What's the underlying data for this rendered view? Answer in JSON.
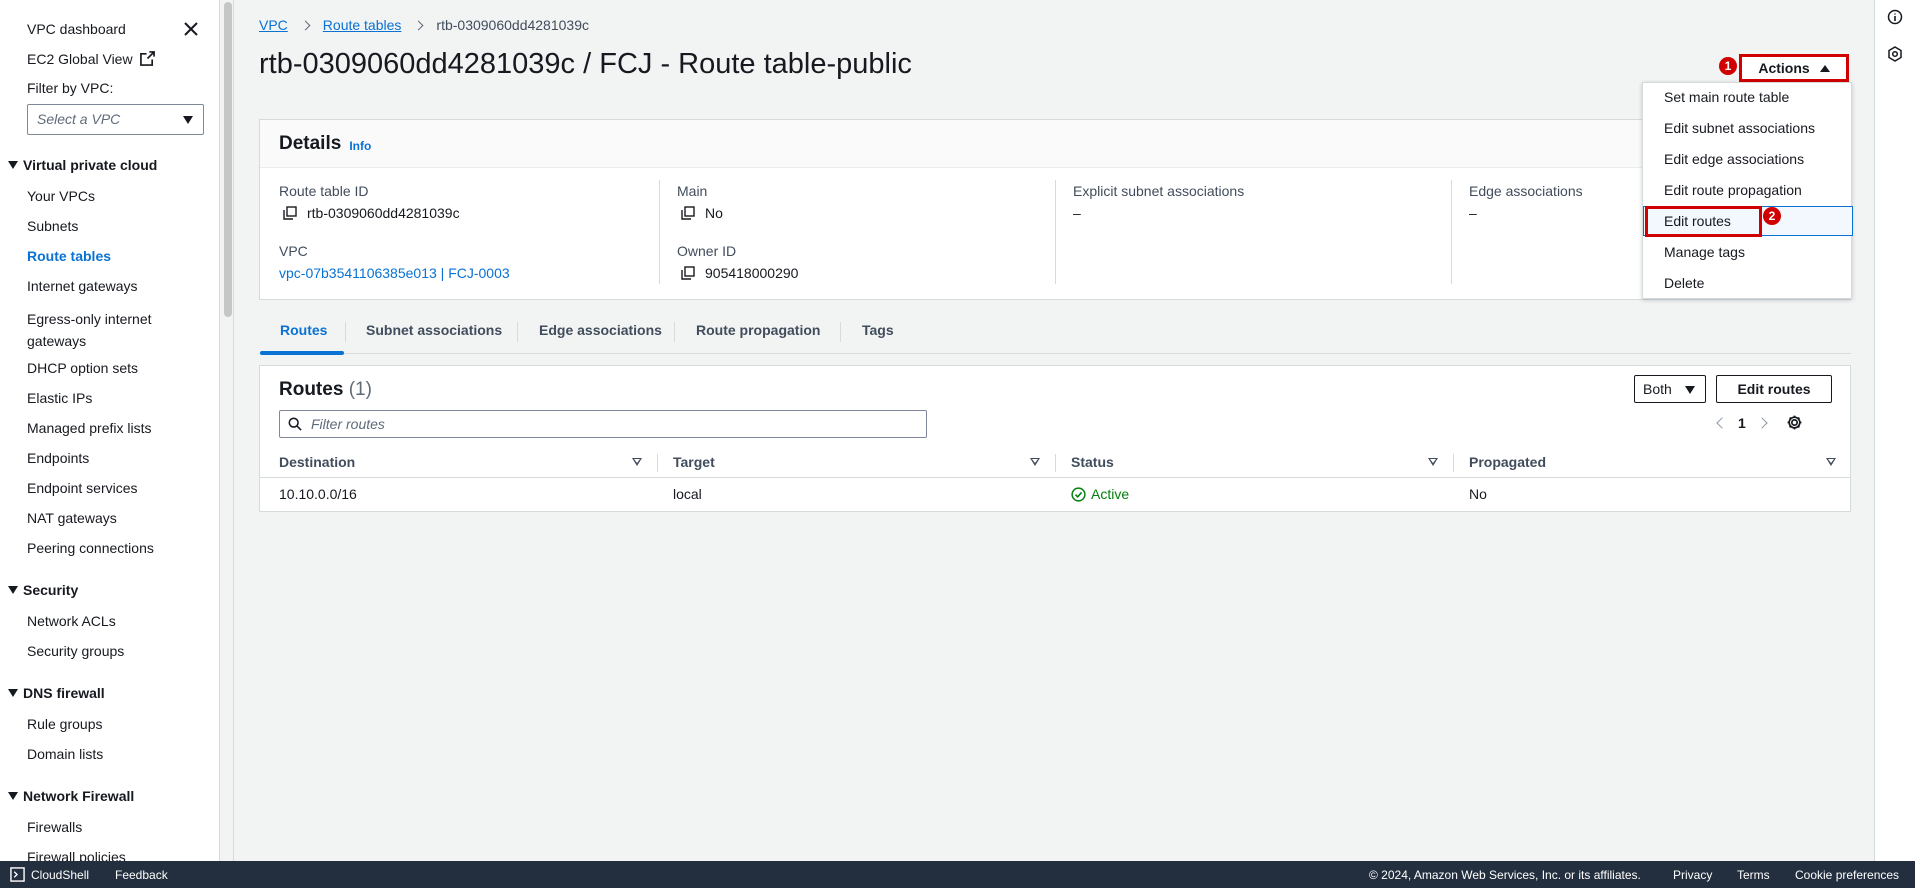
{
  "sidebar": {
    "top_links": [
      "VPC dashboard",
      "EC2 Global View"
    ],
    "filter_label": "Filter by VPC:",
    "vpc_select_placeholder": "Select a VPC",
    "sections": [
      {
        "title": "Virtual private cloud",
        "items": [
          "Your VPCs",
          "Subnets",
          "Route tables",
          "Internet gateways",
          "Egress-only internet gateways",
          "DHCP option sets",
          "Elastic IPs",
          "Managed prefix lists",
          "Endpoints",
          "Endpoint services",
          "NAT gateways",
          "Peering connections"
        ]
      },
      {
        "title": "Security",
        "items": [
          "Network ACLs",
          "Security groups"
        ]
      },
      {
        "title": "DNS firewall",
        "items": [
          "Rule groups",
          "Domain lists"
        ]
      },
      {
        "title": "Network Firewall",
        "items": [
          "Firewalls",
          "Firewall policies"
        ]
      }
    ],
    "active_item": "Route tables"
  },
  "breadcrumb": [
    "VPC",
    "Route tables",
    "rtb-0309060dd4281039c"
  ],
  "page_title": "rtb-0309060dd4281039c / FCJ - Route table-public",
  "actions": {
    "label": "Actions",
    "badge_1": "1",
    "badge_2": "2",
    "menu": [
      "Set main route table",
      "Edit subnet associations",
      "Edit edge associations",
      "Edit route propagation",
      "Edit routes",
      "Manage tags",
      "Delete"
    ],
    "highlighted": "Edit routes"
  },
  "details": {
    "title": "Details",
    "info": "Info",
    "route_table_id_label": "Route table ID",
    "route_table_id": "rtb-0309060dd4281039c",
    "vpc_label": "VPC",
    "vpc_value": "vpc-07b3541106385e013 | FCJ-0003",
    "main_label": "Main",
    "main_value": "No",
    "owner_label": "Owner ID",
    "owner_value": "905418000290",
    "explicit_label": "Explicit subnet associations",
    "explicit_value": "–",
    "edge_label": "Edge associations",
    "edge_value": "–"
  },
  "tabs": [
    "Routes",
    "Subnet associations",
    "Edge associations",
    "Route propagation",
    "Tags"
  ],
  "routes": {
    "title": "Routes",
    "count": "(1)",
    "filter_select": "Both",
    "edit_button": "Edit routes",
    "filter_placeholder": "Filter routes",
    "page": "1",
    "columns": [
      "Destination",
      "Target",
      "Status",
      "Propagated"
    ],
    "rows": [
      {
        "destination": "10.10.0.0/16",
        "target": "local",
        "status": "Active",
        "propagated": "No"
      }
    ]
  },
  "footer": {
    "cloudshell": "CloudShell",
    "feedback": "Feedback",
    "copyright": "© 2024, Amazon Web Services, Inc. or its affiliates.",
    "privacy": "Privacy",
    "terms": "Terms",
    "cookie": "Cookie preferences"
  },
  "colors": {
    "accent": "#0972d3",
    "highlight_red": "#d10000",
    "success": "#037f0c",
    "footer_bg": "#232f3e"
  }
}
